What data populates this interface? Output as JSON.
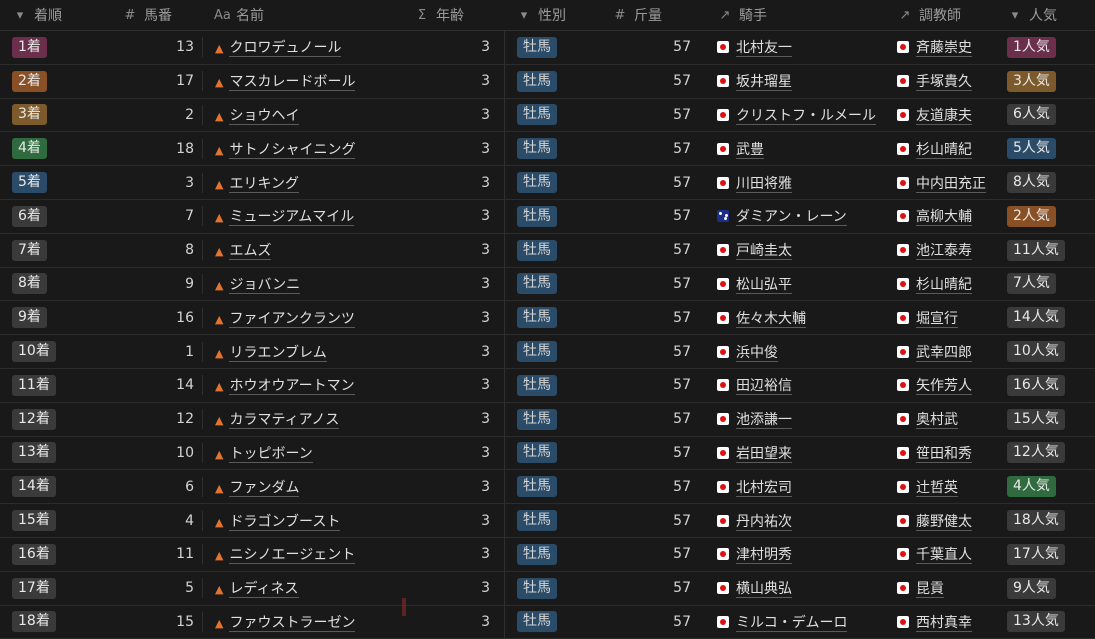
{
  "headers": {
    "chakujun": {
      "icon": "▾",
      "label": "着順"
    },
    "umaban": {
      "icon": "#",
      "label": "馬番"
    },
    "name": {
      "icon": "Aa",
      "label": "名前"
    },
    "age": {
      "icon": "Σ",
      "label": "年齢"
    },
    "sex": {
      "icon": "▾",
      "label": "性別"
    },
    "weight": {
      "icon": "#",
      "label": "斤量"
    },
    "jockey": {
      "icon": "↗",
      "label": "騎手"
    },
    "trainer": {
      "icon": "↗",
      "label": "調教師"
    },
    "popularity": {
      "icon": "▾",
      "label": "人気"
    }
  },
  "colors": {
    "pink": "#6b2f4c",
    "orange": "#8a5025",
    "brown": "#7d5a2c",
    "green": "#2f6b3f",
    "blue": "#2b4c69",
    "gray": "#3a3a3a"
  },
  "rows": [
    {
      "rank": "1着",
      "rank_color": "pink",
      "num": "13",
      "name": "クロワデュノール",
      "age": "3",
      "sex": "牡馬",
      "weight": "57",
      "jockey": "北村友一",
      "jflag": "jp",
      "trainer": "斉藤崇史",
      "pop": "1人気",
      "pop_color": "pink"
    },
    {
      "rank": "2着",
      "rank_color": "orange",
      "num": "17",
      "name": "マスカレードボール",
      "age": "3",
      "sex": "牡馬",
      "weight": "57",
      "jockey": "坂井瑠星",
      "jflag": "jp",
      "trainer": "手塚貴久",
      "pop": "3人気",
      "pop_color": "brown"
    },
    {
      "rank": "3着",
      "rank_color": "brown",
      "num": "2",
      "name": "ショウヘイ",
      "age": "3",
      "sex": "牡馬",
      "weight": "57",
      "jockey": "クリストフ・ルメール",
      "jflag": "jp",
      "trainer": "友道康夫",
      "pop": "6人気",
      "pop_color": "gray"
    },
    {
      "rank": "4着",
      "rank_color": "green",
      "num": "18",
      "name": "サトノシャイニング",
      "age": "3",
      "sex": "牡馬",
      "weight": "57",
      "jockey": "武豊",
      "jflag": "jp",
      "trainer": "杉山晴紀",
      "pop": "5人気",
      "pop_color": "blue"
    },
    {
      "rank": "5着",
      "rank_color": "blue",
      "num": "3",
      "name": "エリキング",
      "age": "3",
      "sex": "牡馬",
      "weight": "57",
      "jockey": "川田将雅",
      "jflag": "jp",
      "trainer": "中内田充正",
      "pop": "8人気",
      "pop_color": "gray"
    },
    {
      "rank": "6着",
      "rank_color": "gray",
      "num": "7",
      "name": "ミュージアムマイル",
      "age": "3",
      "sex": "牡馬",
      "weight": "57",
      "jockey": "ダミアン・レーン",
      "jflag": "au",
      "trainer": "高柳大輔",
      "pop": "2人気",
      "pop_color": "orange"
    },
    {
      "rank": "7着",
      "rank_color": "gray",
      "num": "8",
      "name": "エムズ",
      "age": "3",
      "sex": "牡馬",
      "weight": "57",
      "jockey": "戸崎圭太",
      "jflag": "jp",
      "trainer": "池江泰寿",
      "pop": "11人気",
      "pop_color": "gray"
    },
    {
      "rank": "8着",
      "rank_color": "gray",
      "num": "9",
      "name": "ジョバンニ",
      "age": "3",
      "sex": "牡馬",
      "weight": "57",
      "jockey": "松山弘平",
      "jflag": "jp",
      "trainer": "杉山晴紀",
      "pop": "7人気",
      "pop_color": "gray"
    },
    {
      "rank": "9着",
      "rank_color": "gray",
      "num": "16",
      "name": "ファイアンクランツ",
      "age": "3",
      "sex": "牡馬",
      "weight": "57",
      "jockey": "佐々木大輔",
      "jflag": "jp",
      "trainer": "堀宣行",
      "pop": "14人気",
      "pop_color": "gray"
    },
    {
      "rank": "10着",
      "rank_color": "gray",
      "num": "1",
      "name": "リラエンブレム",
      "age": "3",
      "sex": "牡馬",
      "weight": "57",
      "jockey": "浜中俊",
      "jflag": "jp",
      "trainer": "武幸四郎",
      "pop": "10人気",
      "pop_color": "gray"
    },
    {
      "rank": "11着",
      "rank_color": "gray",
      "num": "14",
      "name": "ホウオウアートマン",
      "age": "3",
      "sex": "牡馬",
      "weight": "57",
      "jockey": "田辺裕信",
      "jflag": "jp",
      "trainer": "矢作芳人",
      "pop": "16人気",
      "pop_color": "gray"
    },
    {
      "rank": "12着",
      "rank_color": "gray",
      "num": "12",
      "name": "カラマティアノス",
      "age": "3",
      "sex": "牡馬",
      "weight": "57",
      "jockey": "池添謙一",
      "jflag": "jp",
      "trainer": "奥村武",
      "pop": "15人気",
      "pop_color": "gray"
    },
    {
      "rank": "13着",
      "rank_color": "gray",
      "num": "10",
      "name": "トッピボーン",
      "age": "3",
      "sex": "牡馬",
      "weight": "57",
      "jockey": "岩田望来",
      "jflag": "jp",
      "trainer": "笹田和秀",
      "pop": "12人気",
      "pop_color": "gray"
    },
    {
      "rank": "14着",
      "rank_color": "gray",
      "num": "6",
      "name": "ファンダム",
      "age": "3",
      "sex": "牡馬",
      "weight": "57",
      "jockey": "北村宏司",
      "jflag": "jp",
      "trainer": "辻哲英",
      "pop": "4人気",
      "pop_color": "green"
    },
    {
      "rank": "15着",
      "rank_color": "gray",
      "num": "4",
      "name": "ドラゴンブースト",
      "age": "3",
      "sex": "牡馬",
      "weight": "57",
      "jockey": "丹内祐次",
      "jflag": "jp",
      "trainer": "藤野健太",
      "pop": "18人気",
      "pop_color": "gray"
    },
    {
      "rank": "16着",
      "rank_color": "gray",
      "num": "11",
      "name": "ニシノエージェント",
      "age": "3",
      "sex": "牡馬",
      "weight": "57",
      "jockey": "津村明秀",
      "jflag": "jp",
      "trainer": "千葉直人",
      "pop": "17人気",
      "pop_color": "gray"
    },
    {
      "rank": "17着",
      "rank_color": "gray",
      "num": "5",
      "name": "レディネス",
      "age": "3",
      "sex": "牡馬",
      "weight": "57",
      "jockey": "横山典弘",
      "jflag": "jp",
      "trainer": "昆貢",
      "pop": "9人気",
      "pop_color": "gray"
    },
    {
      "rank": "18着",
      "rank_color": "gray",
      "num": "15",
      "name": "ファウストラーゼン",
      "age": "3",
      "sex": "牡馬",
      "weight": "57",
      "jockey": "ミルコ・デムーロ",
      "jflag": "jp",
      "trainer": "西村真幸",
      "pop": "13人気",
      "pop_color": "gray"
    }
  ]
}
